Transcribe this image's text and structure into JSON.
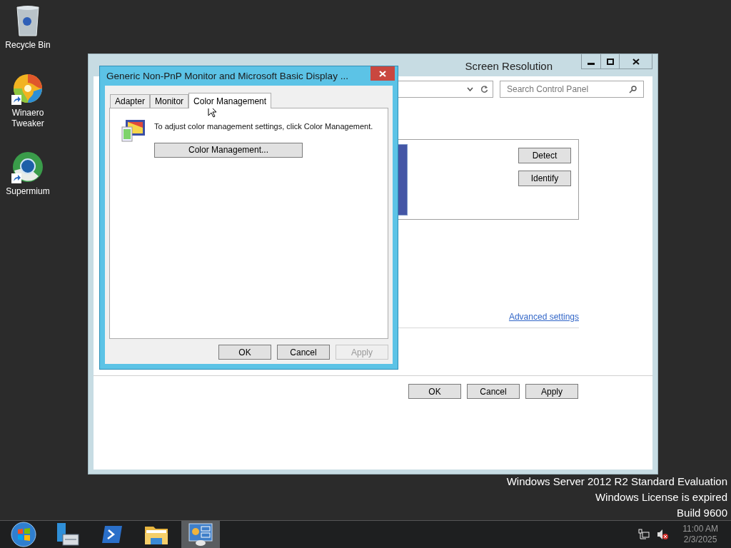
{
  "desktop_icons": [
    {
      "label": "Recycle Bin",
      "kind": "bin"
    },
    {
      "label": "Winaero Tweaker",
      "kind": "swirl",
      "shortcut": true
    },
    {
      "label": "Supermium",
      "kind": "browser",
      "shortcut": true
    }
  ],
  "main_window": {
    "title": "Screen Resolution",
    "search": {
      "placeholder": "Search Control Panel"
    },
    "display_buttons": [
      "Detect",
      "Identify"
    ],
    "link": "Advanced settings",
    "buttons": [
      {
        "label": "OK",
        "disabled": false
      },
      {
        "label": "Cancel",
        "disabled": false
      },
      {
        "label": "Apply",
        "disabled": false
      }
    ]
  },
  "dialog": {
    "title": "Generic Non-PnP Monitor and Microsoft Basic Display ...",
    "tabs": [
      {
        "label": "Adapter",
        "selected": false
      },
      {
        "label": "Monitor",
        "selected": false
      },
      {
        "label": "Color Management",
        "selected": true
      }
    ],
    "message": "To adjust color management settings, click Color Management.",
    "action_button": "Color Management...",
    "buttons": [
      {
        "label": "OK",
        "disabled": false
      },
      {
        "label": "Cancel",
        "disabled": false
      },
      {
        "label": "Apply",
        "disabled": true
      }
    ]
  },
  "watermark": [
    "Windows Server 2012 R2 Standard Evaluation",
    "Windows License is expired",
    "Build 9600"
  ],
  "taskbar": {
    "items": [
      {
        "kind": "start",
        "selected": false
      },
      {
        "kind": "server",
        "selected": false
      },
      {
        "kind": "shell",
        "selected": false
      },
      {
        "kind": "folder",
        "selected": false
      },
      {
        "kind": "panel",
        "selected": true
      }
    ],
    "clock": {
      "time": "11:00 AM",
      "date": "2/3/2025"
    }
  }
}
